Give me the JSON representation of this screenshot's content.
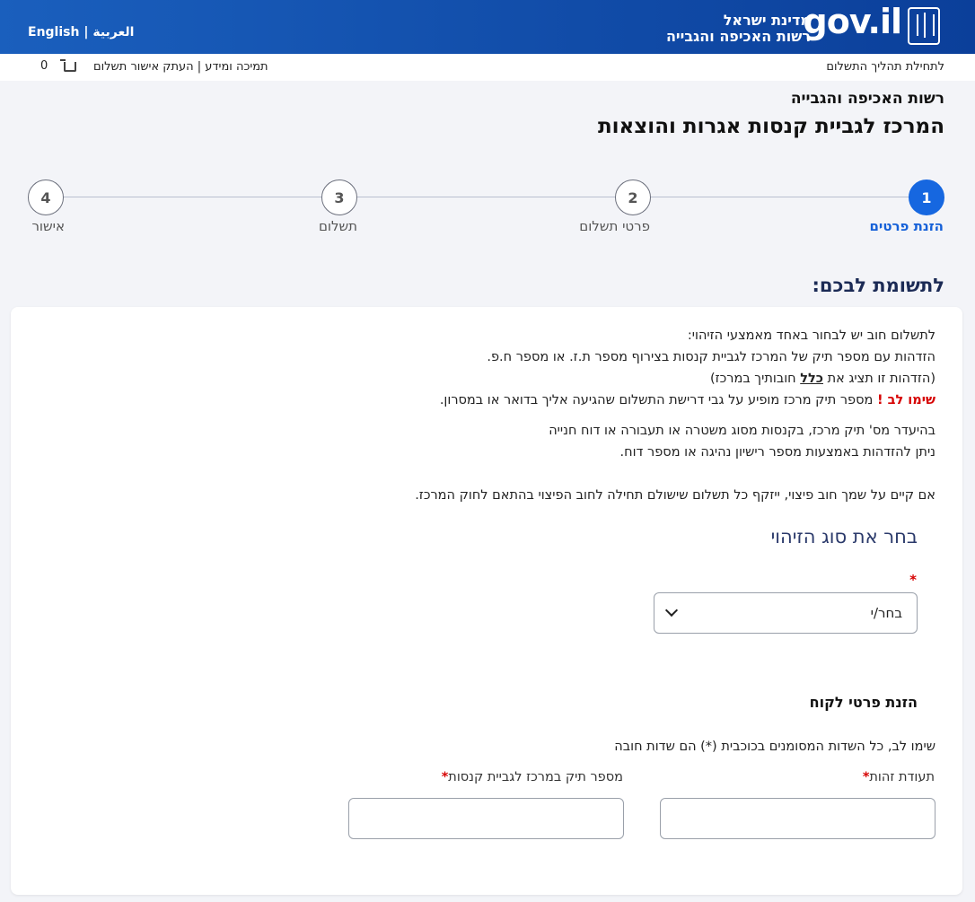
{
  "header": {
    "logo_text": "gov.il",
    "agency_line1": "מדינת ישראל",
    "agency_line2": "רשות האכיפה והגבייה",
    "lang_arabic": "العربية",
    "lang_separator": "|",
    "lang_english": "English"
  },
  "subbar": {
    "start_link": "לתחילת תהליך התשלום",
    "help_links": "תמיכה ומידע | העתק אישור תשלום",
    "cart_count": "0"
  },
  "titles": {
    "authority": "רשות האכיפה והגבייה",
    "center": "המרכז לגביית קנסות אגרות והוצאות"
  },
  "steps": [
    {
      "number": "1",
      "label": "הזנת פרטים",
      "active": true
    },
    {
      "number": "2",
      "label": "פרטי תשלום",
      "active": false
    },
    {
      "number": "3",
      "label": "תשלום",
      "active": false
    },
    {
      "number": "4",
      "label": "אישור",
      "active": false
    }
  ],
  "attention": "לתשומת לבכם:",
  "info": {
    "line1": "לתשלום חוב יש לבחור באחד מאמצעי הזיהוי:",
    "line2": "הזדהות עם מספר תיק של המרכז לגביית קנסות בצירוף מספר ת.ז. או מספר ח.פ.",
    "line3_pre": "(הזדהות זו תציג את ",
    "line3_bold": "כלל",
    "line3_post": " חובותיך במרכז)",
    "line4_warn": "שימו לב !",
    "line4_rest": " מספר תיק מרכז מופיע על גבי דרישת התשלום שהגיעה אליך בדואר או במסרון.",
    "line5": "בהיעדר מס' תיק מרכז, בקנסות מסוג משטרה או תעבורה או דוח חנייה",
    "line6": "ניתן להזדהות באמצעות מספר רישיון נהיגה או מספר דוח.",
    "line7": "אם קיים על שמך חוב פיצוי, ייזקף כל תשלום שישולם תחילה לחוב הפיצוי בהתאם לחוק המרכז."
  },
  "id_type": {
    "title": "בחר את סוג הזיהוי",
    "required_mark": "*",
    "selected": "בחר/י"
  },
  "client": {
    "title": "הזנת פרטי לקוח",
    "note": "שימו לב, כל השדות המסומנים בכוכבית (*) הם שדות חובה",
    "id_label": "תעודת זהות",
    "case_label": "מספר תיק במרכז לגביית קנסות",
    "required_mark": "*",
    "id_value": "",
    "case_value": ""
  }
}
